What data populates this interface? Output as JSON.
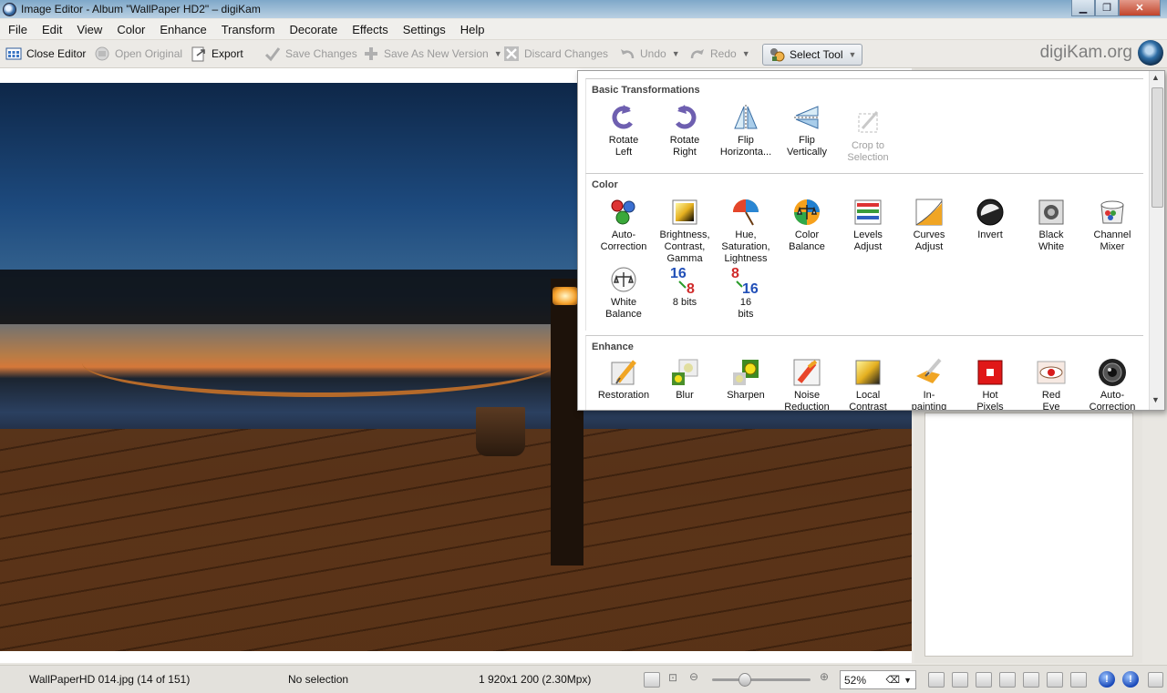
{
  "window": {
    "title": "Image Editor - Album \"WallPaper HD2\" – digiKam"
  },
  "menu": [
    "File",
    "Edit",
    "View",
    "Color",
    "Enhance",
    "Transform",
    "Decorate",
    "Effects",
    "Settings",
    "Help"
  ],
  "toolbar": {
    "close_editor": "Close Editor",
    "open_original": "Open Original",
    "export": "Export",
    "save_changes": "Save Changes",
    "save_as_new": "Save As New Version",
    "discard": "Discard Changes",
    "undo": "Undo",
    "redo": "Redo",
    "select_tool": "Select Tool",
    "brand": "digiKam.org"
  },
  "popup": {
    "basic": {
      "title": "Basic Transformations",
      "tools": [
        {
          "label": "Rotate\nLeft",
          "icon": "rotate-left-icon"
        },
        {
          "label": "Rotate\nRight",
          "icon": "rotate-right-icon"
        },
        {
          "label": "Flip\nHorizonta...",
          "icon": "flip-horizontal-icon"
        },
        {
          "label": "Flip\nVertically",
          "icon": "flip-vertical-icon"
        },
        {
          "label": "Crop to\nSelection",
          "icon": "crop-icon",
          "disabled": true
        }
      ]
    },
    "color": {
      "title": "Color",
      "tools": [
        {
          "label": "Auto-\nCorrection",
          "icon": "auto-color-icon"
        },
        {
          "label": "Brightness,\nContrast,\nGamma",
          "icon": "brightness-icon"
        },
        {
          "label": "Hue,\nSaturation,\nLightness",
          "icon": "hue-umbrella-icon"
        },
        {
          "label": "Color\nBalance",
          "icon": "color-balance-icon"
        },
        {
          "label": "Levels\nAdjust",
          "icon": "levels-icon"
        },
        {
          "label": "Curves\nAdjust",
          "icon": "curves-icon"
        },
        {
          "label": "Invert",
          "icon": "invert-icon"
        },
        {
          "label": "Black\nWhite",
          "icon": "black-white-icon"
        },
        {
          "label": "Channel\nMixer",
          "icon": "channel-mixer-icon"
        },
        {
          "label": "White\nBalance",
          "icon": "white-balance-icon"
        },
        {
          "label": "8 bits",
          "icon": "16-to-8-bits-icon"
        },
        {
          "label": "16\nbits",
          "icon": "8-to-16-bits-icon"
        }
      ]
    },
    "enhance": {
      "title": "Enhance",
      "tools": [
        {
          "label": "Restoration",
          "icon": "restoration-icon"
        },
        {
          "label": "Blur",
          "icon": "blur-icon"
        },
        {
          "label": "Sharpen",
          "icon": "sharpen-icon"
        },
        {
          "label": "Noise\nReduction",
          "icon": "noise-reduction-icon"
        },
        {
          "label": "Local\nContrast",
          "icon": "local-contrast-icon"
        },
        {
          "label": "In-\npainting",
          "icon": "inpainting-icon"
        },
        {
          "label": "Hot\nPixels",
          "icon": "hot-pixels-icon"
        },
        {
          "label": "Red\nEye",
          "icon": "red-eye-icon"
        },
        {
          "label": "Auto-\nCorrection",
          "icon": "lens-auto-correction-icon"
        }
      ]
    }
  },
  "status": {
    "filename": "WallPaperHD 014.jpg (14 of 151)",
    "selection": "No selection",
    "dimensions": "1 920x1 200 (2.30Mpx)",
    "zoom": "52%",
    "zoom_fraction": 0.32
  }
}
